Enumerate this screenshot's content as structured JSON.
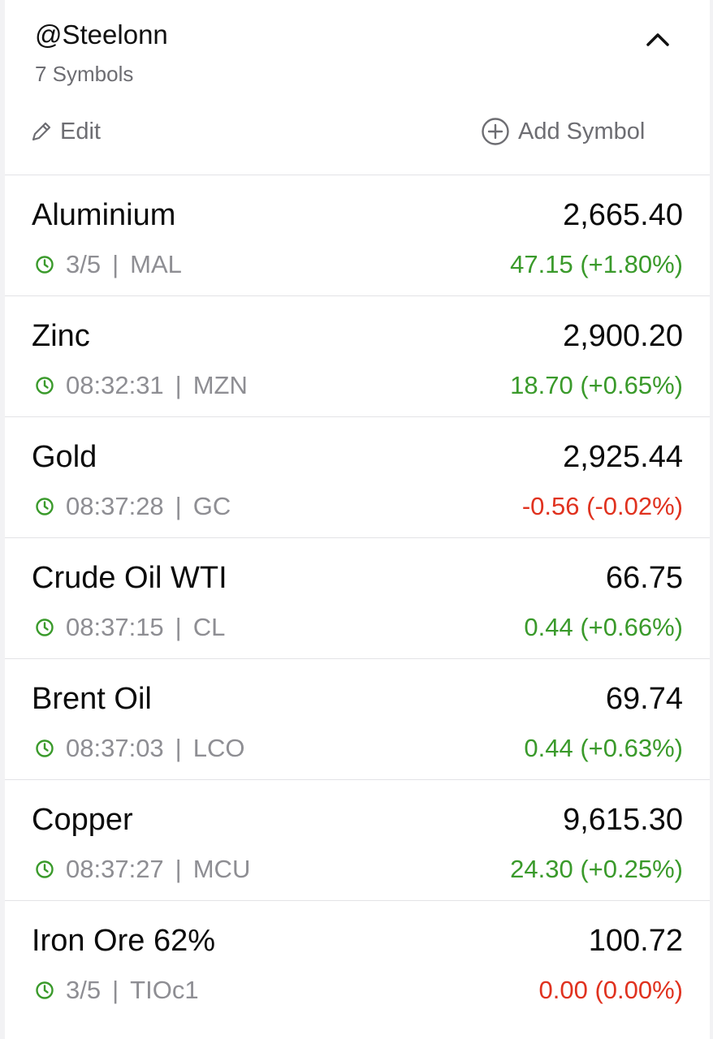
{
  "watchlist": {
    "name": "@Steelonn",
    "count_label": "7 Symbols",
    "edit_label": "Edit",
    "add_label": "Add Symbol"
  },
  "colors": {
    "up": "#3a9a2b",
    "down": "#e0321f",
    "clock": "#3a9a2b"
  },
  "rows": [
    {
      "name": "Aluminium",
      "price": "2,665.40",
      "time": "3/5",
      "ticker": "MAL",
      "change": "47.15 (+1.80%)",
      "dir": "up"
    },
    {
      "name": "Zinc",
      "price": "2,900.20",
      "time": "08:32:31",
      "ticker": "MZN",
      "change": "18.70 (+0.65%)",
      "dir": "up"
    },
    {
      "name": "Gold",
      "price": "2,925.44",
      "time": "08:37:28",
      "ticker": "GC",
      "change": "-0.56 (-0.02%)",
      "dir": "down"
    },
    {
      "name": "Crude Oil WTI",
      "price": "66.75",
      "time": "08:37:15",
      "ticker": "CL",
      "change": "0.44 (+0.66%)",
      "dir": "up"
    },
    {
      "name": "Brent Oil",
      "price": "69.74",
      "time": "08:37:03",
      "ticker": "LCO",
      "change": "0.44 (+0.63%)",
      "dir": "up"
    },
    {
      "name": "Copper",
      "price": "9,615.30",
      "time": "08:37:27",
      "ticker": "MCU",
      "change": "24.30 (+0.25%)",
      "dir": "up"
    },
    {
      "name": "Iron Ore 62%",
      "price": "100.72",
      "time": "3/5",
      "ticker": "TIOc1",
      "change": "0.00 (0.00%)",
      "dir": "down"
    }
  ]
}
